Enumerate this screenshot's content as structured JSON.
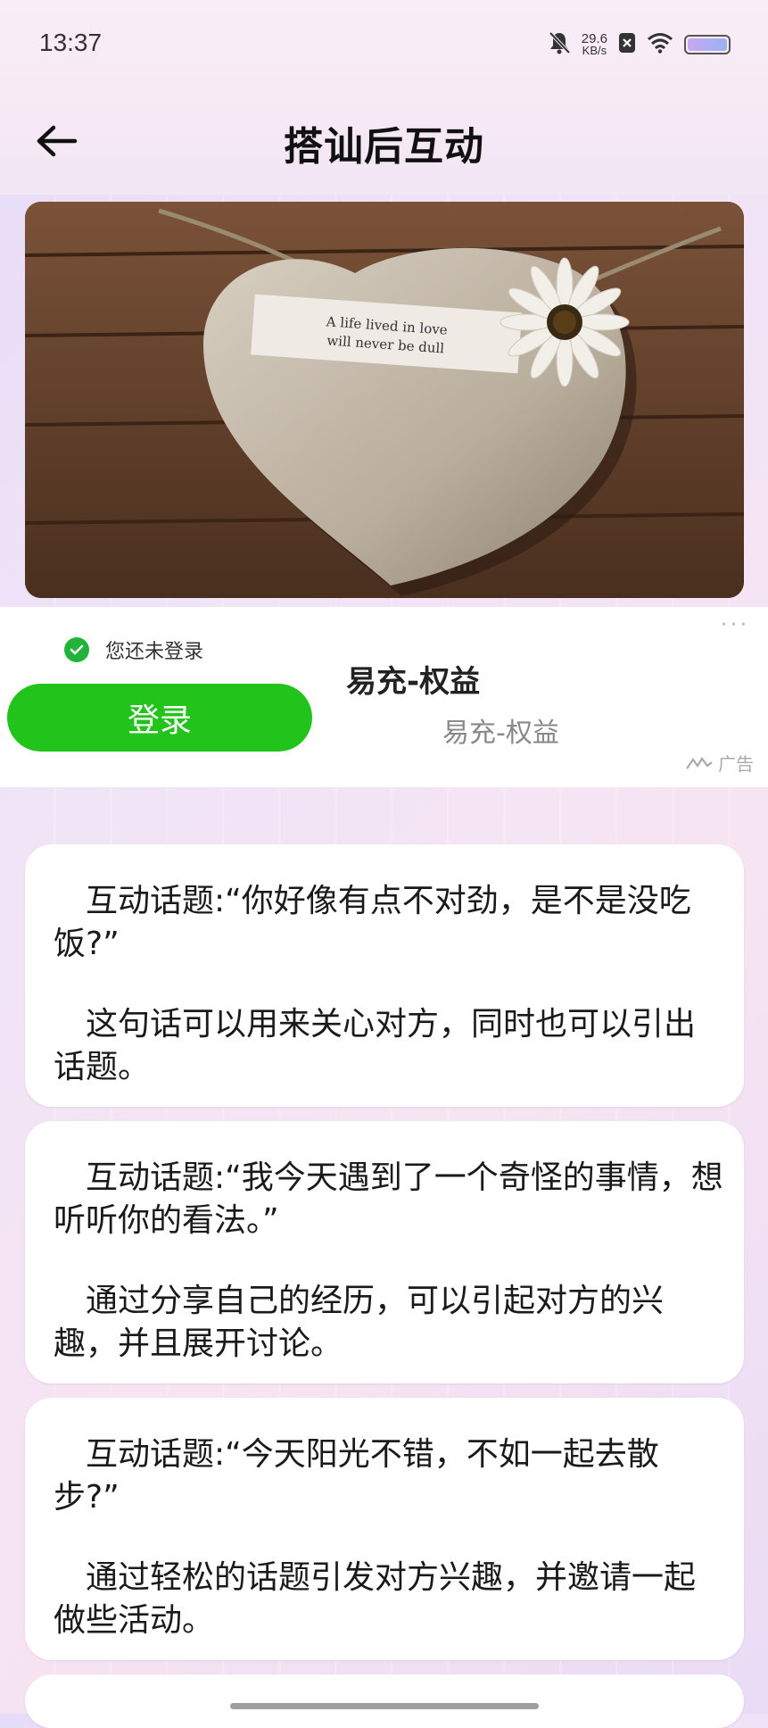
{
  "status_bar": {
    "time": "13:37",
    "net_speed_value": "29.6",
    "net_speed_unit": "KB/s"
  },
  "header": {
    "title": "搭讪后互动"
  },
  "banner": {
    "note_text_line1": "A life lived in love",
    "note_text_line2": "will never be dull"
  },
  "ad": {
    "login_status": "您还未登录",
    "login_button": "登录",
    "title": "易充-权益",
    "subtitle": "易充-权益",
    "label": "广告",
    "more": "···"
  },
  "topics": [
    {
      "topic": "互动话题:“你好像有点不对劲，是不是没吃饭?”",
      "desc": "这句话可以用来关心对方，同时也可以引出话题。"
    },
    {
      "topic": "互动话题:“我今天遇到了一个奇怪的事情，想听听你的看法。”",
      "desc": "通过分享自己的经历，可以引起对方的兴趣，并且展开讨论。"
    },
    {
      "topic": "互动话题:“今天阳光不错，不如一起去散步?”",
      "desc": "通过轻松的话题引发对方兴趣，并邀请一起做些活动。"
    }
  ],
  "colors": {
    "login_button": "#22c41b",
    "check_icon": "#22b33a"
  }
}
